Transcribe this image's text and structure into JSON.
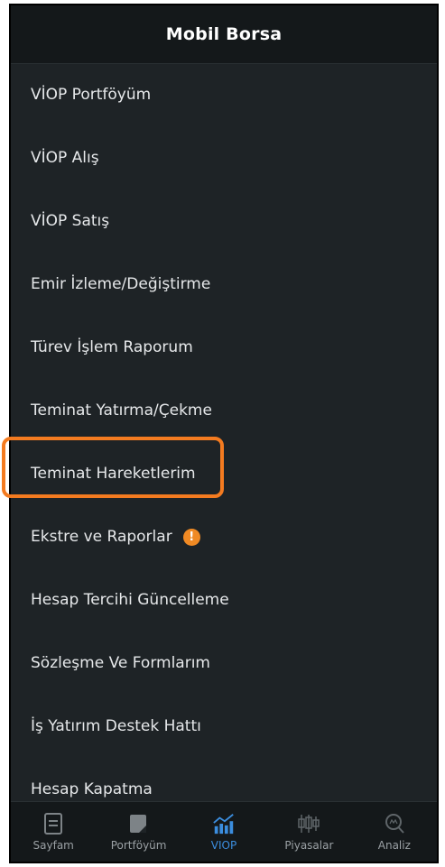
{
  "header": {
    "title": "Mobil Borsa"
  },
  "menu": {
    "items": [
      {
        "label": "VİOP Portföyüm"
      },
      {
        "label": "VİOP Alış"
      },
      {
        "label": "VİOP Satış"
      },
      {
        "label": "Emir İzleme/Değiştirme"
      },
      {
        "label": "Türev İşlem Raporum"
      },
      {
        "label": "Teminat Yatırma/Çekme"
      },
      {
        "label": "Teminat Hareketlerim"
      },
      {
        "label": "Ekstre ve Raporlar",
        "badge": "!"
      },
      {
        "label": "Hesap Tercihi Güncelleme"
      },
      {
        "label": "Sözleşme Ve Formlarım"
      },
      {
        "label": "İş Yatırım Destek Hattı"
      },
      {
        "label": "Hesap Kapatma"
      }
    ]
  },
  "tabbar": {
    "tabs": [
      {
        "label": "Sayfam",
        "icon": "page-icon"
      },
      {
        "label": "Portföyüm",
        "icon": "portfolio-icon"
      },
      {
        "label": "VIOP",
        "icon": "viop-chart-icon",
        "active": true
      },
      {
        "label": "Piyasalar",
        "icon": "candlestick-icon"
      },
      {
        "label": "Analiz",
        "icon": "magnifier-icon"
      }
    ]
  },
  "colors": {
    "background": "#1e2326",
    "header": "#14181a",
    "text": "#e6e8ea",
    "highlight": "#f47b20",
    "badge": "#f08a24",
    "active_tab": "#3b8dde",
    "inactive_tab": "#9aa0a4"
  }
}
